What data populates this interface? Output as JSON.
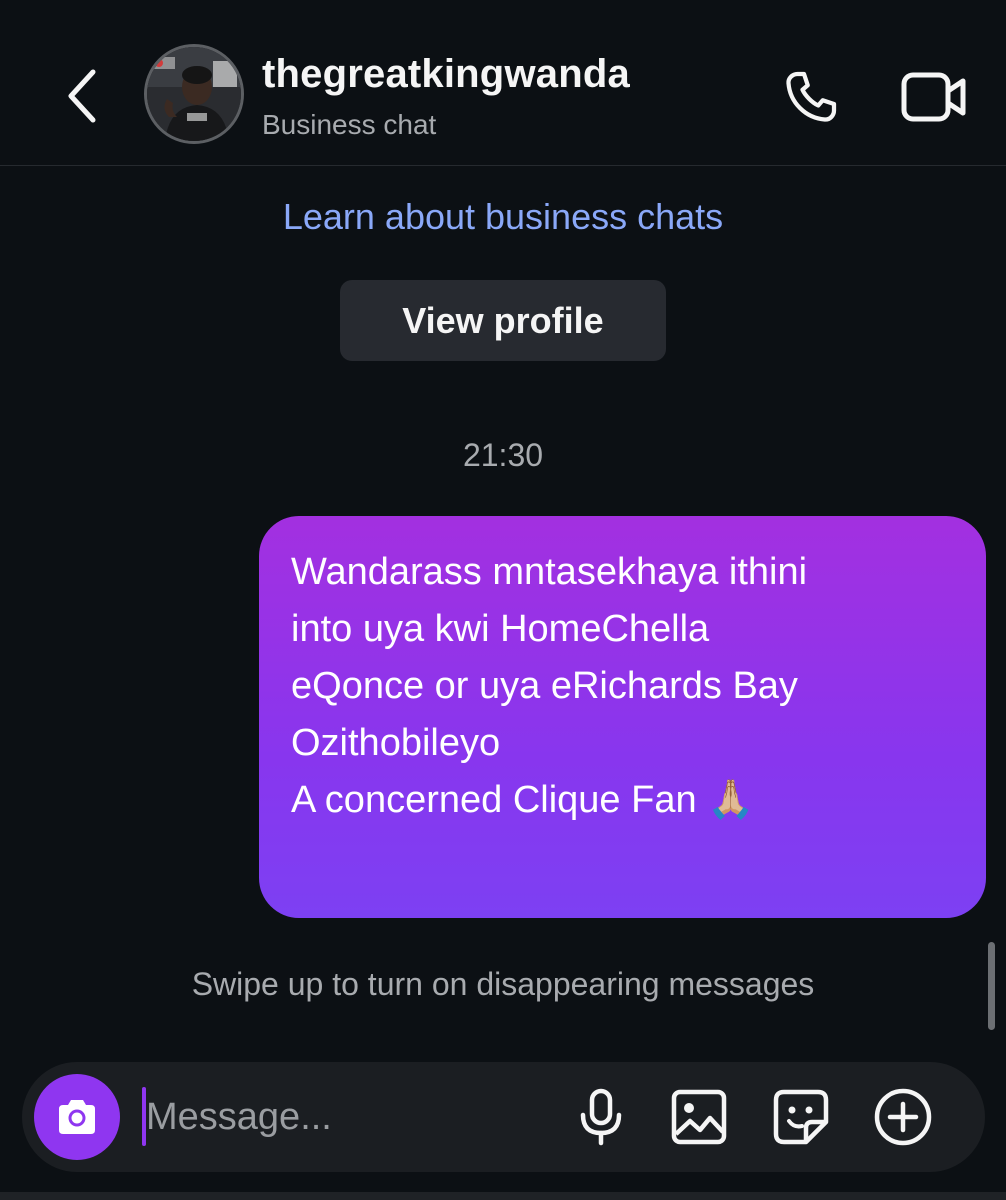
{
  "header": {
    "title": "thegreatkingwanda",
    "subtitle": "Business chat",
    "back_icon": "chevron-left-icon",
    "call_icon": "phone-icon",
    "video_icon": "video-camera-icon"
  },
  "chat": {
    "learn_link": "Learn about business chats",
    "view_profile_label": "View profile",
    "timestamp": "21:30",
    "messages": [
      {
        "direction": "outgoing",
        "lines": [
          "Wandarass mntasekhaya ithini",
          "into uya kwi HomeChella",
          "eQonce or uya eRichards Bay",
          "",
          "Ozithobileyo",
          "A concerned Clique Fan 🙏🏼"
        ]
      }
    ],
    "disappearing_hint": "Swipe up to turn on disappearing messages"
  },
  "composer": {
    "placeholder": "Message...",
    "camera_icon": "camera-icon",
    "mic_icon": "microphone-icon",
    "gallery_icon": "image-icon",
    "sticker_icon": "sticker-icon",
    "add_icon": "plus-circle-icon"
  },
  "colors": {
    "background": "#0c1014",
    "bubble_gradient_top": "#a330e0",
    "bubble_gradient_bottom": "#7d40f3",
    "link": "#8aa8f8",
    "accent": "#8f36f0"
  }
}
